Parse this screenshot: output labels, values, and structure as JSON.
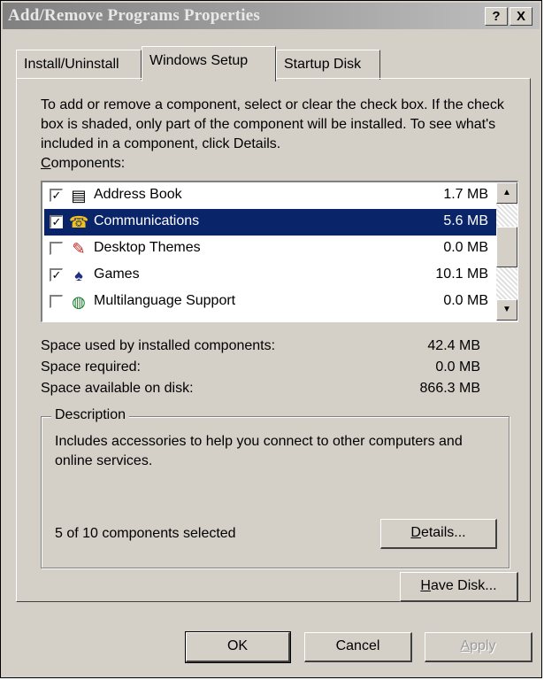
{
  "window": {
    "title": "Add/Remove Programs Properties",
    "help_label": "?",
    "close_label": "X"
  },
  "tabs": [
    {
      "label": "Install/Uninstall",
      "active": false
    },
    {
      "label": "Windows Setup",
      "active": true
    },
    {
      "label": "Startup Disk",
      "active": false
    }
  ],
  "instructions": "To add or remove a component, select or clear the check box. If the check box is shaded, only part of the component will be installed. To see what's included in a component, click Details.",
  "components_label": {
    "accel": "C",
    "rest": "omponents:"
  },
  "components": [
    {
      "name": "Address Book",
      "size": "1.7 MB",
      "checked": true,
      "icon": "address-book-icon",
      "glyph": "▤"
    },
    {
      "name": "Communications",
      "size": "5.6 MB",
      "checked": true,
      "selected": true,
      "icon": "communications-icon",
      "glyph": "☎"
    },
    {
      "name": "Desktop Themes",
      "size": "0.0 MB",
      "checked": false,
      "icon": "desktop-themes-icon",
      "glyph": "✎"
    },
    {
      "name": "Games",
      "size": "10.1 MB",
      "checked": true,
      "icon": "games-icon",
      "glyph": "♠"
    },
    {
      "name": "Multilanguage Support",
      "size": "0.0 MB",
      "checked": false,
      "icon": "globe-icon",
      "glyph": "◍"
    }
  ],
  "stats": [
    {
      "label": "Space used by installed components:",
      "value": "42.4 MB"
    },
    {
      "label": "Space required:",
      "value": "0.0 MB"
    },
    {
      "label": "Space available on disk:",
      "value": "866.3 MB"
    }
  ],
  "description": {
    "title": "Description",
    "text": "Includes accessories to help you connect to other computers and online services.",
    "selected_count": "5 of 10 components selected",
    "details_button": {
      "accel": "D",
      "rest": "etails..."
    }
  },
  "have_disk_button": {
    "accel": "H",
    "rest": "ave Disk..."
  },
  "footer": {
    "ok": "OK",
    "cancel": "Cancel",
    "apply": {
      "accel": "A",
      "rest": "pply"
    }
  },
  "colors": {
    "selection": "#0a246a",
    "face": "#d4d0c8"
  }
}
